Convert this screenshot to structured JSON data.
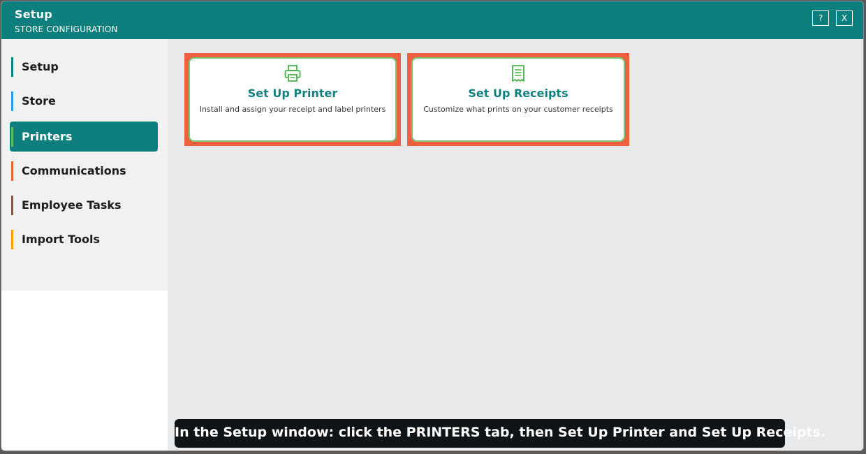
{
  "window": {
    "title": "Setup",
    "subtitle": "STORE CONFIGURATION",
    "help_label": "?",
    "close_label": "X"
  },
  "sidebar": {
    "items": [
      {
        "label": "Setup",
        "accent": "#0e7f7f",
        "active": false
      },
      {
        "label": "Store",
        "accent": "#2f9be8",
        "active": false
      },
      {
        "label": "Printers",
        "accent": "#5dbb63",
        "active": true
      },
      {
        "label": "Communications",
        "accent": "#f0603d",
        "active": false
      },
      {
        "label": "Employee Tasks",
        "accent": "#7a5548",
        "active": false
      },
      {
        "label": "Import Tools",
        "accent": "#ffa000",
        "active": false
      }
    ]
  },
  "cards": [
    {
      "title": "Set Up Printer",
      "description": "Install and assign your receipt and label printers",
      "icon": "printer-icon"
    },
    {
      "title": "Set Up Receipts",
      "description": "Customize what prints on your customer receipts",
      "icon": "receipt-icon"
    }
  ],
  "caption": "In the Setup window: click the PRINTERS tab, then Set Up Printer and Set Up Receipts.",
  "colors": {
    "brand": "#0e7f7f",
    "highlight": "#f0603d",
    "card_border": "#7cc47c"
  }
}
